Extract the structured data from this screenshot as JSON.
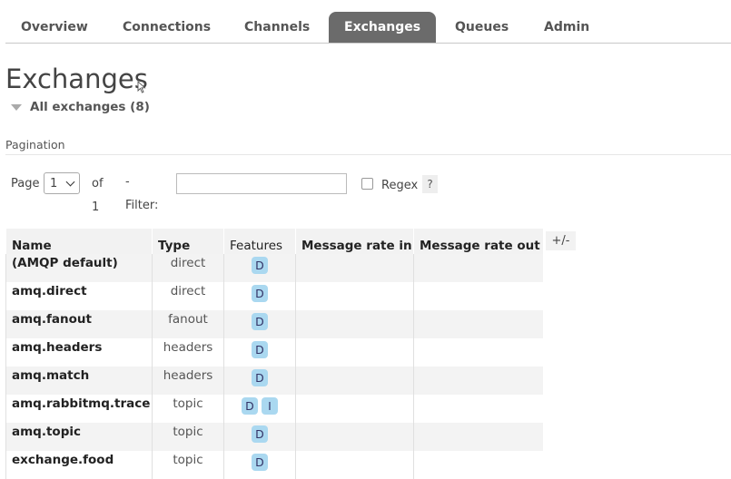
{
  "tabs": [
    {
      "label": "Overview"
    },
    {
      "label": "Connections"
    },
    {
      "label": "Channels"
    },
    {
      "label": "Exchanges"
    },
    {
      "label": "Queues"
    },
    {
      "label": "Admin"
    }
  ],
  "active_tab": "Exchanges",
  "page_title": "Exchanges",
  "section_toggle": "All exchanges (8)",
  "pagination": {
    "label": "Pagination",
    "page_label": "Page",
    "page_value": "1",
    "of_label": "of 1",
    "filter_label": "- Filter:",
    "filter_value": "",
    "regex_label": "Regex",
    "help": "?"
  },
  "table": {
    "columns": [
      "Name",
      "Type",
      "Features",
      "Message rate in",
      "Message rate out"
    ],
    "plusminus": "+/-",
    "rows": [
      {
        "name": "(AMQP default)",
        "type": "direct",
        "features": [
          "D"
        ]
      },
      {
        "name": "amq.direct",
        "type": "direct",
        "features": [
          "D"
        ]
      },
      {
        "name": "amq.fanout",
        "type": "fanout",
        "features": [
          "D"
        ]
      },
      {
        "name": "amq.headers",
        "type": "headers",
        "features": [
          "D"
        ]
      },
      {
        "name": "amq.match",
        "type": "headers",
        "features": [
          "D"
        ]
      },
      {
        "name": "amq.rabbitmq.trace",
        "type": "topic",
        "features": [
          "D",
          "I"
        ]
      },
      {
        "name": "amq.topic",
        "type": "topic",
        "features": [
          "D"
        ]
      },
      {
        "name": "exchange.food",
        "type": "topic",
        "features": [
          "D"
        ]
      }
    ]
  },
  "colors": {
    "active_tab_bg": "#6b6b6b",
    "badge_bg": "#aad8f0"
  }
}
